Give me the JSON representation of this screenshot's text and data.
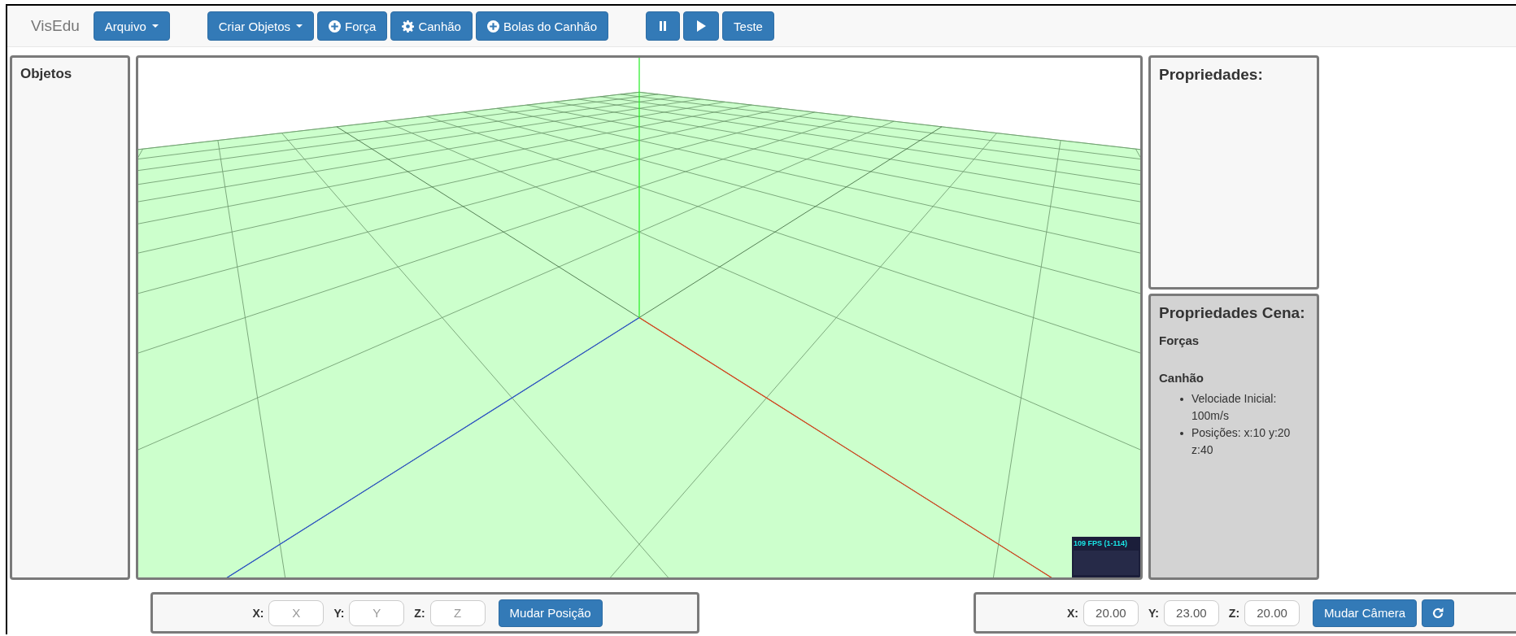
{
  "brand": "VisEdu",
  "toolbar_groups": [
    {
      "buttons": [
        {
          "kind": "dropdown",
          "label": "Arquivo"
        }
      ]
    },
    {
      "buttons": [
        {
          "kind": "dropdown",
          "label": "Criar Objetos"
        },
        {
          "kind": "add",
          "label": "Força"
        },
        {
          "kind": "gear",
          "label": "Canhão"
        },
        {
          "kind": "add",
          "label": "Bolas do Canhão"
        }
      ]
    },
    {
      "buttons": [
        {
          "kind": "pause"
        },
        {
          "kind": "play"
        },
        {
          "kind": "text",
          "label": "Teste"
        }
      ]
    }
  ],
  "objects_panel": {
    "title": "Objetos"
  },
  "viewport": {
    "fps": "109 FPS (1-114)"
  },
  "properties_panel": {
    "title": "Propriedades:"
  },
  "scene_panel": {
    "title": "Propriedades Cena:",
    "sections": [
      {
        "heading": "Forças"
      },
      {
        "heading": "Canhão",
        "items": [
          "Velociade Inicial: 100m/s",
          "Posições: x:10 y:20 z:40"
        ]
      }
    ]
  },
  "position_bar": {
    "fields": [
      {
        "label": "X:",
        "placeholder": "X"
      },
      {
        "label": "Y:",
        "placeholder": "Y"
      },
      {
        "label": "Z:",
        "placeholder": "Z"
      }
    ],
    "buttons": [
      {
        "kind": "text",
        "label": "Mudar Posição"
      }
    ]
  },
  "camera_bar": {
    "fields": [
      {
        "label": "X:",
        "value": "20.00"
      },
      {
        "label": "Y:",
        "value": "23.00"
      },
      {
        "label": "Z:",
        "value": "20.00"
      }
    ],
    "buttons": [
      {
        "kind": "text",
        "label": "Mudar Câmera"
      },
      {
        "kind": "refresh"
      }
    ]
  }
}
